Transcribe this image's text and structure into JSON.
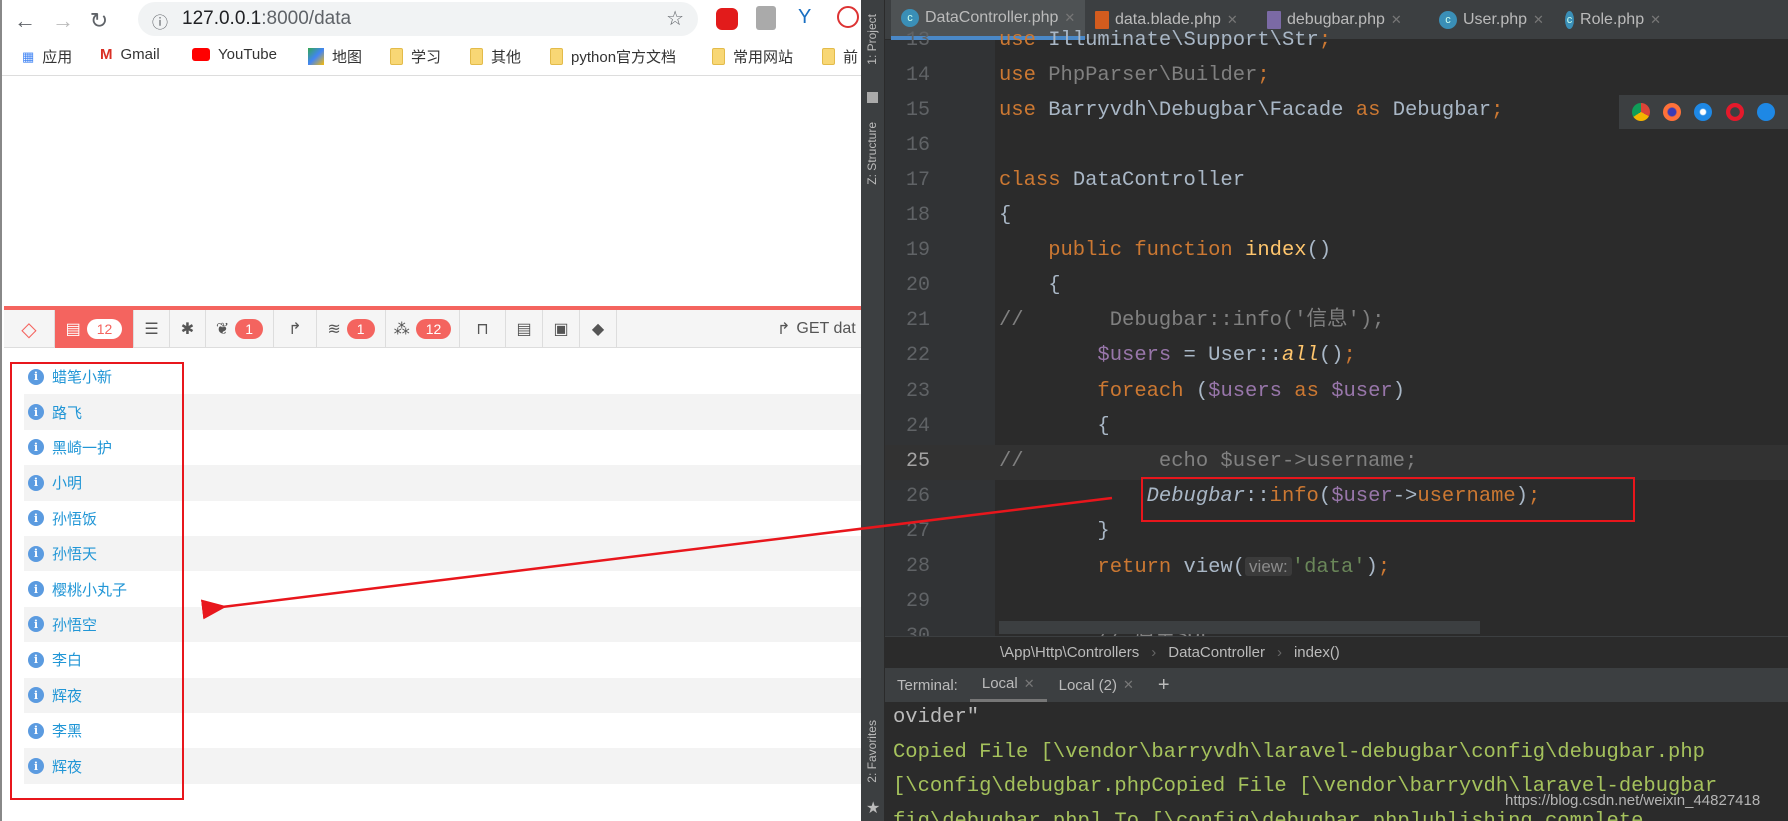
{
  "browser": {
    "url_host": "127.0.0.1",
    "url_rest": ":8000/data",
    "bookmarks": [
      "应用",
      "Gmail",
      "YouTube",
      "地图",
      "学习",
      "其他",
      "python官方文档",
      "常用网站",
      "前"
    ]
  },
  "debugbar": {
    "tabs": [
      {
        "icon": "messages-icon",
        "badge": "12"
      },
      {
        "icon": "timeline-icon"
      },
      {
        "icon": "exceptions-bug-icon"
      },
      {
        "icon": "views-leaf-icon",
        "badge": "1"
      },
      {
        "icon": "route-share-icon"
      },
      {
        "icon": "queries-database-icon",
        "badge": "1"
      },
      {
        "icon": "models-cubes-icon",
        "badge": "12"
      },
      {
        "icon": "mails-inbox-icon"
      },
      {
        "icon": "gate-list-icon"
      },
      {
        "icon": "session-archive-icon"
      },
      {
        "icon": "request-tags-icon"
      }
    ],
    "request_label": "GET dat",
    "messages": [
      "蜡笔小新",
      "路飞",
      "黑崎一护",
      "小明",
      "孙悟饭",
      "孙悟天",
      "樱桃小丸子",
      "孙悟空",
      "李白",
      "辉夜",
      "李黑",
      "辉夜"
    ]
  },
  "ide": {
    "side_tools": [
      "1: Project",
      "Z: Structure",
      "2: Favorites"
    ],
    "file_tabs": [
      {
        "label": "DataController.php",
        "type": "class"
      },
      {
        "label": "data.blade.php",
        "type": "blade"
      },
      {
        "label": "debugbar.php",
        "type": "php"
      },
      {
        "label": "User.php",
        "type": "class"
      },
      {
        "label": "Role.php",
        "type": "class"
      }
    ],
    "active_tab": "DataController.php",
    "code": [
      {
        "n": "13",
        "tokens": [
          [
            "kw",
            "use "
          ],
          [
            "",
            "Illuminate\\Support\\Str"
          ],
          [
            "kw",
            ";"
          ]
        ]
      },
      {
        "n": "14",
        "tokens": [
          [
            "kw",
            "use "
          ],
          [
            "cm",
            "PhpParser\\Builder"
          ],
          [
            "kw",
            ";"
          ]
        ]
      },
      {
        "n": "15",
        "tokens": [
          [
            "kw",
            "use "
          ],
          [
            "",
            "Barryvdh\\Debugbar\\Facade "
          ],
          [
            "kw",
            "as "
          ],
          [
            "",
            "Debugbar"
          ],
          [
            "kw",
            ";"
          ]
        ]
      },
      {
        "n": "16",
        "tokens": []
      },
      {
        "n": "17",
        "tokens": [
          [
            "kw",
            "class "
          ],
          [
            "",
            "DataController"
          ]
        ]
      },
      {
        "n": "18",
        "tokens": [
          [
            "",
            "{"
          ]
        ]
      },
      {
        "n": "19",
        "tokens": [
          [
            "kw",
            "    public function "
          ],
          [
            "fn",
            "index"
          ],
          [
            "",
            "()"
          ]
        ]
      },
      {
        "n": "20",
        "tokens": [
          [
            "",
            "    {"
          ]
        ]
      },
      {
        "n": "21",
        "tokens": [
          [
            "cm",
            "//       Debugbar::info('信息');"
          ]
        ]
      },
      {
        "n": "22",
        "tokens": [
          [
            "var",
            "        $users"
          ],
          [
            "",
            " = User::"
          ],
          [
            "fn it",
            "all"
          ],
          [
            "",
            "()"
          ],
          [
            "kw",
            ";"
          ]
        ]
      },
      {
        "n": "23",
        "tokens": [
          [
            "kw",
            "        foreach "
          ],
          [
            "",
            "("
          ],
          [
            "var",
            "$users "
          ],
          [
            "kw",
            "as "
          ],
          [
            "var",
            "$user"
          ],
          [
            "",
            ")"
          ]
        ]
      },
      {
        "n": "24",
        "tokens": [
          [
            "",
            "        {"
          ]
        ]
      },
      {
        "n": "25",
        "tokens": [
          [
            "cm",
            "//           echo $user->username;"
          ]
        ]
      },
      {
        "n": "26",
        "tokens": [
          [
            "it",
            "            Debugbar"
          ],
          [
            "",
            "::"
          ],
          [
            "kw",
            "info"
          ],
          [
            "",
            "("
          ],
          [
            "var",
            "$user"
          ],
          [
            "",
            "->"
          ],
          [
            "kw",
            "username"
          ],
          [
            "",
            ")"
          ],
          [
            "kw",
            ";"
          ]
        ]
      },
      {
        "n": "27",
        "tokens": [
          [
            "",
            "        }"
          ]
        ]
      },
      {
        "n": "28",
        "tokens": [
          [
            "kw",
            "        return "
          ],
          [
            "",
            "view("
          ],
          [
            "hint",
            "view:"
          ],
          [
            "str",
            "'data'"
          ],
          [
            "",
            ")"
          ],
          [
            "kw",
            ";"
          ]
        ]
      },
      {
        "n": "29",
        "tokens": []
      },
      {
        "n": "30",
        "tokens": [
          [
            "cm",
            "        // 原生SQL"
          ]
        ]
      }
    ],
    "breadcrumb": [
      "\\App\\Http\\Controllers",
      "DataController",
      "index()"
    ],
    "terminal": {
      "label": "Terminal:",
      "tabs": [
        "Local",
        "Local (2)"
      ],
      "add": "+",
      "lines": [
        {
          "text": "ovider\"",
          "color": "plain"
        },
        {
          "text": "Copied File [\\vendor\\barryvdh\\laravel-debugbar\\config\\debugbar.php",
          "color": "yellow"
        },
        {
          "text": "[\\config\\debugbar.phpCopied File [\\vendor\\barryvdh\\laravel-debugbar",
          "color": "yellow"
        },
        {
          "text": "fig\\debugbar.php] To [\\config\\debugbar.php]ublishing complete.",
          "color": "yellow"
        }
      ]
    },
    "browser_icons": [
      "chrome-icon",
      "firefox-icon",
      "safari-icon",
      "opera-icon",
      "ie-icon"
    ]
  },
  "watermark": "https://blog.csdn.net/weixin_44827418",
  "colors": {
    "debugbar_accent": "#f4645f",
    "annotation": "#e8161c",
    "link": "#2196d6"
  }
}
